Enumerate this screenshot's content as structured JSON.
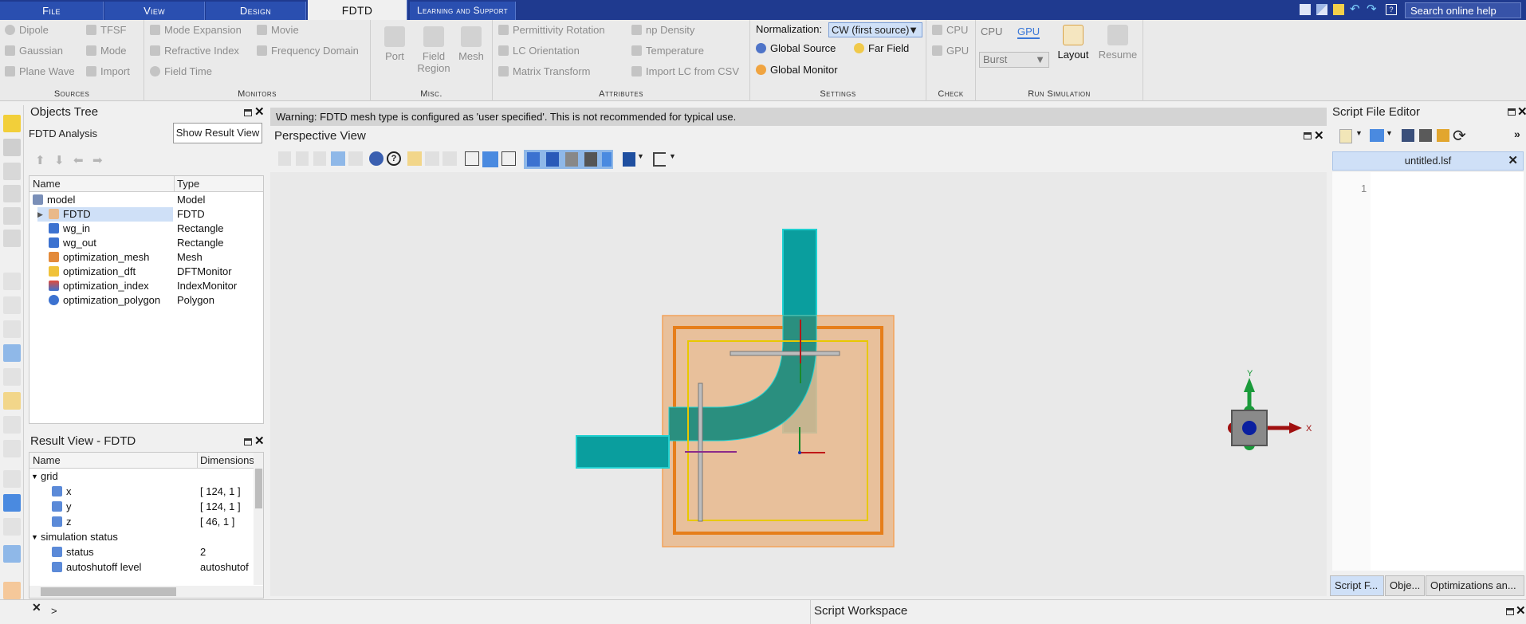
{
  "tabs": [
    {
      "label": "File"
    },
    {
      "label": "View"
    },
    {
      "label": "Design"
    },
    {
      "label": "FDTD"
    },
    {
      "label": "Learning and Support"
    }
  ],
  "search_label": "Search online help",
  "ribbon": {
    "sources": {
      "title": "Sources",
      "items": [
        "Dipole",
        "Gaussian",
        "Plane Wave",
        "TFSF",
        "Mode",
        "Import"
      ]
    },
    "monitors": {
      "title": "Monitors",
      "items": [
        "Mode Expansion",
        "Refractive Index",
        "Field Time",
        "Movie",
        "Frequency Domain"
      ]
    },
    "misc": {
      "title": "Misc.",
      "items": [
        "Port",
        "Field Region",
        "Mesh"
      ]
    },
    "attributes": {
      "title": "Attributes",
      "items": [
        "Permittivity Rotation",
        "LC Orientation",
        "Matrix Transform",
        "np Density",
        "Temperature",
        "Import LC from CSV"
      ]
    },
    "settings": {
      "title": "Settings",
      "normalization_label": "Normalization:",
      "normalization_value": "CW (first source)",
      "global_source": "Global Source",
      "far_field": "Far Field",
      "global_monitor": "Global Monitor"
    },
    "check": {
      "title": "Check",
      "cpu": "CPU",
      "gpu": "GPU"
    },
    "run": {
      "title": "Run Simulation",
      "cpu_tab": "CPU",
      "gpu_tab": "GPU",
      "mode_value": "Burst",
      "layout": "Layout",
      "resume": "Resume"
    }
  },
  "objects_tree": {
    "title": "Objects Tree",
    "analysis_label": "FDTD Analysis",
    "show_result_view": "Show Result View",
    "col_name": "Name",
    "col_type": "Type",
    "rows": [
      {
        "name": "model",
        "type": "Model"
      },
      {
        "name": "FDTD",
        "type": "FDTD"
      },
      {
        "name": "wg_in",
        "type": "Rectangle"
      },
      {
        "name": "wg_out",
        "type": "Rectangle"
      },
      {
        "name": "optimization_mesh",
        "type": "Mesh"
      },
      {
        "name": "optimization_dft",
        "type": "DFTMonitor"
      },
      {
        "name": "optimization_index",
        "type": "IndexMonitor"
      },
      {
        "name": "optimization_polygon",
        "type": "Polygon"
      }
    ]
  },
  "result_view": {
    "title": "Result View - FDTD",
    "col_name": "Name",
    "col_dims": "Dimensions",
    "rows": [
      {
        "name": "grid",
        "dims": ""
      },
      {
        "name": "x",
        "dims": "[ 124, 1 ]"
      },
      {
        "name": "y",
        "dims": "[ 124, 1 ]"
      },
      {
        "name": "z",
        "dims": "[ 46, 1 ]"
      },
      {
        "name": "simulation status",
        "dims": ""
      },
      {
        "name": "status",
        "dims": "2"
      },
      {
        "name": "autoshutoff level",
        "dims": "autoshutof"
      }
    ]
  },
  "warning": "Warning: FDTD mesh type is configured as 'user specified'. This is not recommended for typical use.",
  "perspective_title": "Perspective View",
  "axes": {
    "y": "Y",
    "x": "X"
  },
  "script_editor": {
    "title": "Script File Editor",
    "file_tab": "untitled.lsf",
    "line_number": "1",
    "bottom_tabs": [
      "Script F...",
      "Obje...",
      "Optimizations an..."
    ]
  },
  "prompt": ">",
  "script_workspace": "Script Workspace",
  "colors": {
    "tabbar": "#1f3a8f",
    "waveguide": "#0a9e9e",
    "region": "#e8b98d",
    "fdtd_border": "#e67e1a",
    "mesh_border": "#e8c800"
  }
}
